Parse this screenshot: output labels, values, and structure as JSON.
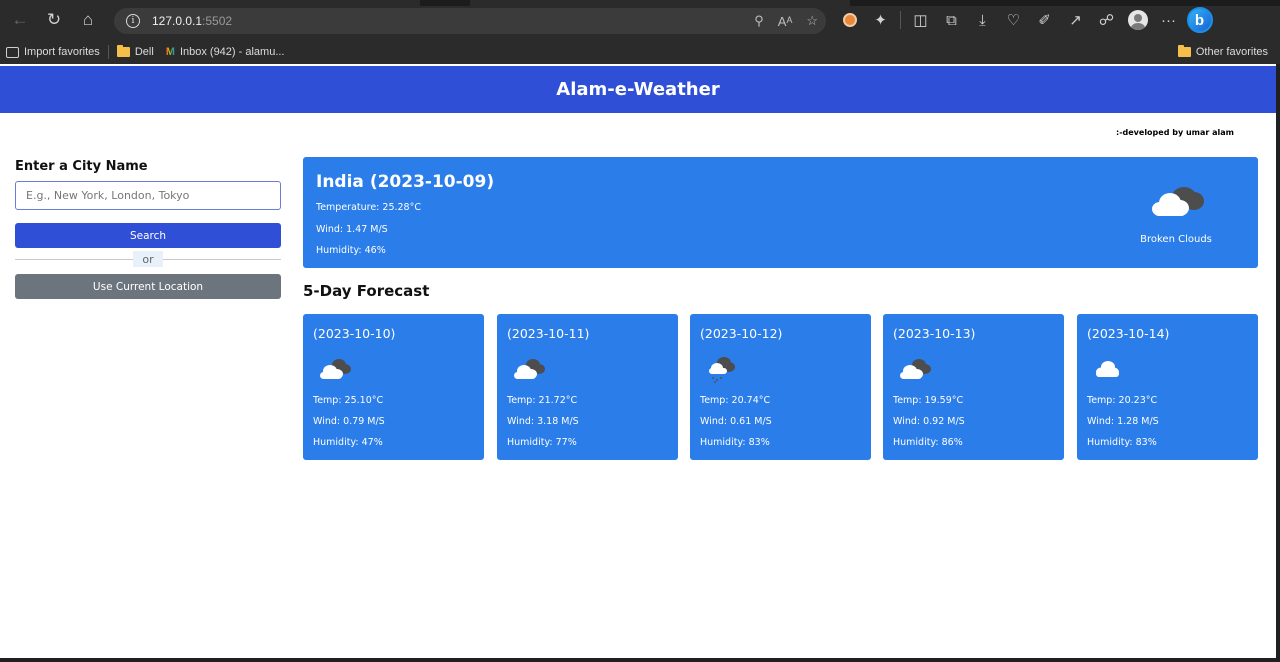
{
  "browser": {
    "url_host": "127.0.0.1",
    "url_port": ":5502",
    "read_aloud": "Aᴬ",
    "bookmarks": [
      {
        "label": "Import favorites",
        "icon": "import-icon"
      },
      {
        "label": "Dell",
        "icon": "folder-icon"
      },
      {
        "label": "Inbox (942) - alamu...",
        "icon": "gmail-icon"
      }
    ],
    "other_favorites": "Other favorites",
    "more": "···"
  },
  "app": {
    "title": "Alam-e-Weather",
    "credit": ":-developed by umar alam"
  },
  "sidebar": {
    "heading": "Enter a City Name",
    "input_placeholder": "E.g., New York, London, Tokyo",
    "input_value": "",
    "search_label": "Search",
    "or_label": "or",
    "location_label": "Use Current Location"
  },
  "current": {
    "title": "India (2023-10-09)",
    "temperature": "Temperature: 25.28°C",
    "wind": "Wind: 1.47 M/S",
    "humidity": "Humidity: 46%",
    "description": "Broken Clouds",
    "icon": "broken-clouds-icon"
  },
  "forecast": {
    "heading": "5-Day Forecast",
    "days": [
      {
        "date": "(2023-10-10)",
        "temp": "Temp: 25.10°C",
        "wind": "Wind: 0.79 M/S",
        "humidity": "Humidity: 47%",
        "icon": "broken-clouds-icon"
      },
      {
        "date": "(2023-10-11)",
        "temp": "Temp: 21.72°C",
        "wind": "Wind: 3.18 M/S",
        "humidity": "Humidity: 77%",
        "icon": "broken-clouds-icon"
      },
      {
        "date": "(2023-10-12)",
        "temp": "Temp: 20.74°C",
        "wind": "Wind: 0.61 M/S",
        "humidity": "Humidity: 83%",
        "icon": "rain-cloud-icon"
      },
      {
        "date": "(2023-10-13)",
        "temp": "Temp: 19.59°C",
        "wind": "Wind: 0.92 M/S",
        "humidity": "Humidity: 86%",
        "icon": "broken-clouds-icon"
      },
      {
        "date": "(2023-10-14)",
        "temp": "Temp: 20.23°C",
        "wind": "Wind: 1.28 M/S",
        "humidity": "Humidity: 83%",
        "icon": "cloud-icon"
      }
    ]
  },
  "colors": {
    "header": "#2f4fd6",
    "card": "#2b7de9",
    "search_button": "#2f4fd6",
    "location_button": "#6c757d"
  }
}
